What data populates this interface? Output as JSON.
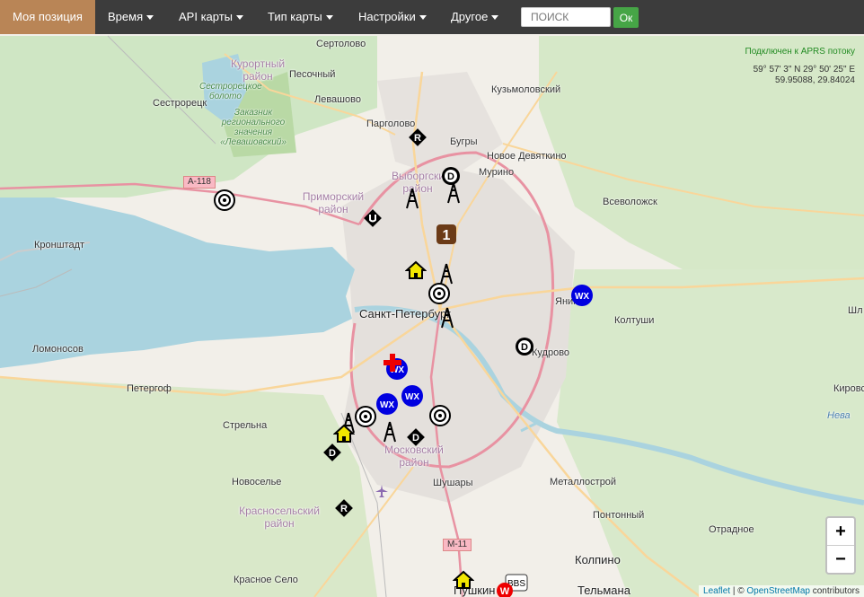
{
  "nav": {
    "active": "Моя позиция",
    "items": [
      "Время",
      "API карты",
      "Тип карты",
      "Настройки",
      "Другое"
    ],
    "search_placeholder": "ПОИСК",
    "ok_label": "Ок"
  },
  "status": {
    "connection": "Подключен к APRS потоку",
    "coord_dms": "59° 57' 3\" N 29° 50' 25\" E",
    "coord_dec": "59.95088, 29.84024"
  },
  "map_labels": {
    "sertolovo": "Сертолово",
    "kurortny": "Курортный район",
    "pesochny": "Песочный",
    "levashovo": "Левашово",
    "kuzmolovsky": "Кузьмоловский",
    "sestroretsk": "Сестрорецк",
    "sestr_bog": "Сестрорецкое болото",
    "zakaznik": "Заказник регионального значения «Левашовский»",
    "pargolovo": "Парголово",
    "bugry": "Бугры",
    "novoe_devyatkino": "Новое Девяткино",
    "vyborgsky": "Выборгский район",
    "murino": "Мурино",
    "primorsky": "Приморский район",
    "vsevolozhsk": "Всеволожск",
    "kronshtadt": "Кронштадт",
    "spb": "Санкт-Петербург",
    "yanino": "Янино",
    "koltushi": "Колтуши",
    "lomonosov": "Ломоносов",
    "kudrovo": "Кудрово",
    "petergof": "Петергоф",
    "strelna": "Стрельна",
    "moskovsky": "Московский район",
    "kirovsk": "Кировск",
    "neva": "Нева",
    "novoselye": "Новоселье",
    "krasnoselsky": "Красносельский район",
    "shushary": "Шушары",
    "metallostroy": "Металлострой",
    "pontonny": "Понтонный",
    "otradnoe": "Отрадное",
    "kolpino": "Колпино",
    "krasnoe_selo": "Красное Село",
    "pushkin": "Пушкин",
    "telmana": "Тельмана",
    "shl": "Шл",
    "a118": "А-118",
    "m11": "М-11"
  },
  "zoom": {
    "in": "+",
    "out": "−"
  },
  "attribution": {
    "leaflet": "Leaflet",
    "sep": " | © ",
    "osm": "OpenStreetMap",
    "contrib": " contributors"
  },
  "markers": {
    "r_symbol": "R",
    "d_symbol": "D",
    "wx_label": "WX",
    "number_label": "1",
    "bbs_label": "BBS",
    "w_label": "W"
  }
}
